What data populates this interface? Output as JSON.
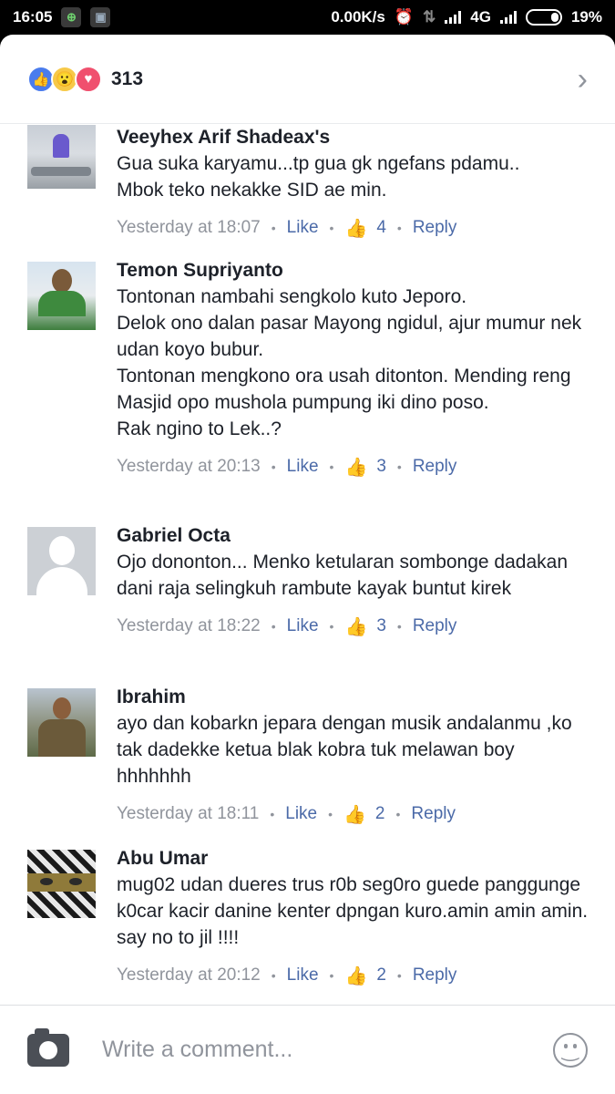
{
  "status_bar": {
    "time": "16:05",
    "net_speed": "0.00K/s",
    "network": "4G",
    "battery": "19%"
  },
  "reactions": {
    "count": "313"
  },
  "comments": [
    {
      "author": "Veeyhex Arif Shadeax's",
      "text": "Gua suka karyamu...tp gua gk ngefans pdamu..\nMbok teko nekakke SID ae min.",
      "time": "Yesterday at 18:07",
      "like_label": "Like",
      "likes": "4",
      "reply_label": "Reply"
    },
    {
      "author": "Temon Supriyanto",
      "text": "Tontonan nambahi sengkolo kuto Jeporo.\nDelok ono dalan pasar Mayong ngidul, ajur mumur nek udan koyo bubur.\nTontonan mengkono ora usah ditonton. Mending reng Masjid opo mushola pumpung iki dino poso.\nRak ngino to Lek..?",
      "time": "Yesterday at 20:13",
      "like_label": "Like",
      "likes": "3",
      "reply_label": "Reply"
    },
    {
      "author": "Gabriel Octa",
      "text": "Ojo dononton... Menko ketularan sombonge dadakan dani raja selingkuh rambute kayak buntut kirek",
      "time": "Yesterday at 18:22",
      "like_label": "Like",
      "likes": "3",
      "reply_label": "Reply"
    },
    {
      "author": "Ibrahim",
      "text": "ayo dan kobarkn jepara dengan musik andalanmu ,ko tak dadekke ketua blak kobra tuk melawan boy hhhhhhh",
      "time": "Yesterday at 18:11",
      "like_label": "Like",
      "likes": "2",
      "reply_label": "Reply"
    },
    {
      "author": "Abu Umar",
      "text": "mug02 udan dueres trus r0b seg0ro guede panggunge k0car kacir danine kenter dpngan kuro.amin amin amin. say no to jil !!!!",
      "time": "Yesterday at 20:12",
      "like_label": "Like",
      "likes": "2",
      "reply_label": "Reply"
    }
  ],
  "composer": {
    "placeholder": "Write a comment..."
  },
  "colors": {
    "link": "#4b6aa8",
    "meta": "#90949c",
    "like_reaction": "#4a7ced",
    "love_reaction": "#f0506e"
  }
}
